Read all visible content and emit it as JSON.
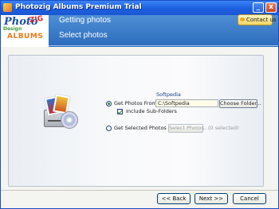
{
  "window": {
    "title": "Photozig Albums Premium Trial",
    "minimize_glyph": "_",
    "close_glyph": "x"
  },
  "header": {
    "logo_photo": "Photo",
    "logo_zig": "ZIG",
    "logo_design": "Design",
    "logo_albums": "ALBUMS",
    "title": "Getting photos",
    "subtitle": "Select photos",
    "contact_label": "Contact us",
    "colors": {
      "header_blue": "#2a6bbd",
      "contact_gold": "#f3d561"
    }
  },
  "options": {
    "folder_hint": "Softpedia",
    "get_from_label": "Get Photos From:",
    "path_value": "C:\\Softpedia",
    "choose_folder_label": "Choose Folder...",
    "include_subfolders_label": "Include Sub-Folders",
    "get_selected_label": "Get Selected Photos",
    "select_photos_label": "Select Photos...",
    "selected_count": "(0 selected)",
    "get_from_selected": true,
    "include_subfolders_checked": true
  },
  "icons": {
    "illustration": "photos-drive-cd-icon"
  },
  "footer": {
    "back_label": "<< Back",
    "next_label": "Next >>",
    "cancel_label": "Cancel"
  }
}
